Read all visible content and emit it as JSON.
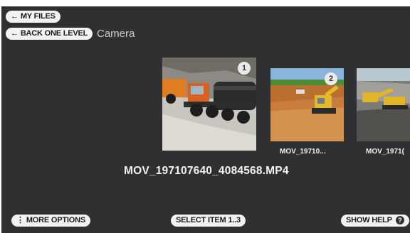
{
  "nav": {
    "my_files_label": "MY FILES",
    "back_label": "BACK ONE LEVEL",
    "breadcrumb": "Camera",
    "back_icon": "arrow-left-icon"
  },
  "carousel": {
    "items": [
      {
        "index": "1",
        "caption": ""
      },
      {
        "index": "2",
        "caption": "MOV_19710..."
      },
      {
        "index": "",
        "caption": "MOV_1971("
      }
    ]
  },
  "selected_filename": "MOV_197107640_4084568.MP4",
  "footer": {
    "more_options_label": "MORE OPTIONS",
    "more_options_icon": "vertical-dots-icon",
    "select_item_label": "SELECT ITEM 1..3",
    "show_help_label": "SHOW HELP",
    "help_icon": "question-icon"
  },
  "colors": {
    "background": "#2f3031",
    "pill_bg": "#f2f2f2"
  }
}
